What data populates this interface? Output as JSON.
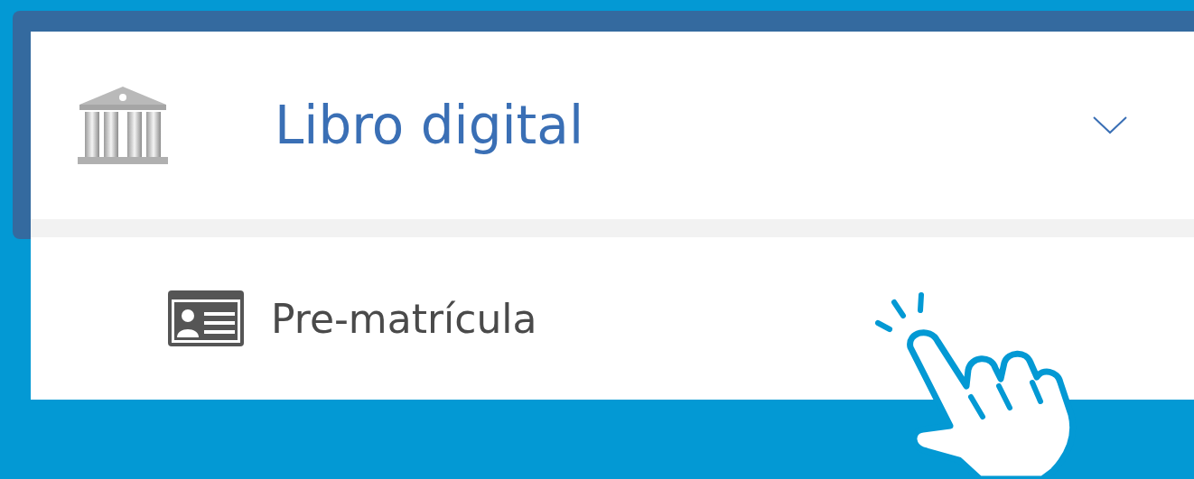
{
  "menu": {
    "title": "Libro digital",
    "expanded": true,
    "items": [
      {
        "label": "Pre-matrícula"
      }
    ]
  }
}
